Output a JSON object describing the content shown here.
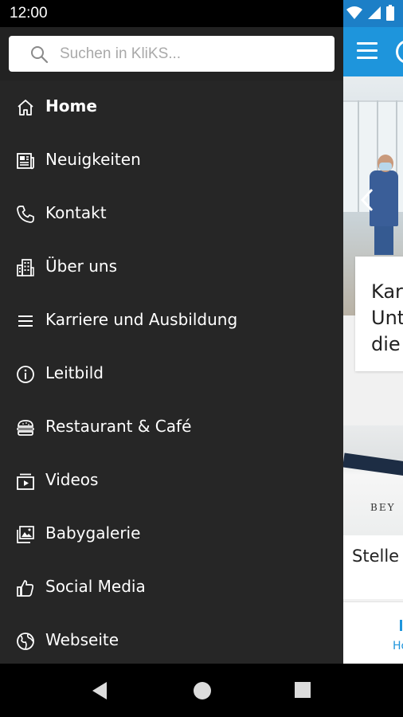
{
  "status": {
    "time": "12:00"
  },
  "search": {
    "placeholder": "Suchen in KliKS..."
  },
  "menu": {
    "items": [
      {
        "label": "Home",
        "icon": "home-icon"
      },
      {
        "label": "Neuigkeiten",
        "icon": "newspaper-icon"
      },
      {
        "label": "Kontakt",
        "icon": "phone-icon"
      },
      {
        "label": "Über uns",
        "icon": "building-icon"
      },
      {
        "label": "Karriere und Ausbildung",
        "icon": "list-icon"
      },
      {
        "label": "Leitbild",
        "icon": "info-icon"
      },
      {
        "label": "Restaurant & Café",
        "icon": "burger-icon"
      },
      {
        "label": "Videos",
        "icon": "video-icon"
      },
      {
        "label": "Babygalerie",
        "icon": "image-icon"
      },
      {
        "label": "Social Media",
        "icon": "thumbs-up-icon"
      },
      {
        "label": "Webseite",
        "icon": "globe-icon"
      }
    ],
    "active_index": 0
  },
  "background_app": {
    "card1_title_lines": [
      "Kar",
      "Unt",
      "die"
    ],
    "card2_title": "Stelle",
    "card2_image_text": "BEY",
    "bottom_nav_label": "Ho"
  },
  "colors": {
    "drawer_bg": "#262626",
    "accent": "#1e95dc"
  }
}
